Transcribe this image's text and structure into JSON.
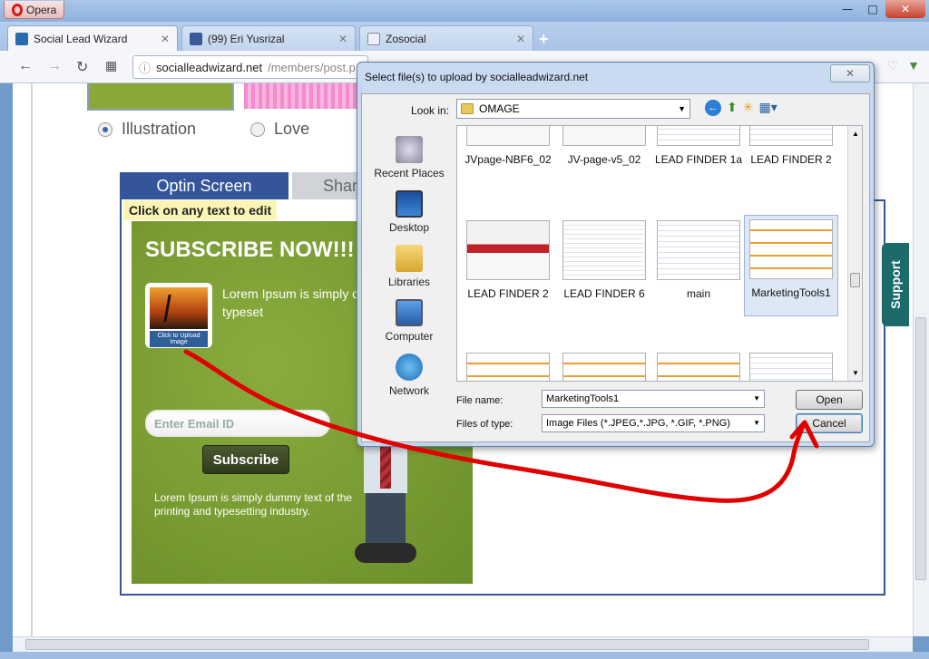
{
  "window": {
    "app_name": "Opera"
  },
  "tabs": [
    {
      "label": "Social Lead Wizard",
      "active": true
    },
    {
      "label": "(99) Eri Yusrizal",
      "active": false
    },
    {
      "label": "Zosocial",
      "active": false
    }
  ],
  "address": {
    "host": "socialleadwizard.net",
    "path": "/members/post.p"
  },
  "page": {
    "radio_options": [
      {
        "label": "Illustration",
        "checked": true
      },
      {
        "label": "Love",
        "checked": false
      }
    ],
    "editor_tabs": {
      "optin": "Optin Screen",
      "share": "Shar"
    },
    "edit_hint": "Click on any text to edit",
    "optin": {
      "title": "SUBSCRIBE NOW!!!",
      "upload_label": "Click to Upload Image",
      "copy1": "Lorem Ipsum is simply d the printing and typeset",
      "email_placeholder": "Enter Email ID",
      "subscribe_label": "Subscribe",
      "copy2": "Lorem Ipsum is simply dummy text of the printing and typesetting industry."
    },
    "support_label": "Support"
  },
  "dialog": {
    "title": "Select file(s) to upload by socialleadwizard.net",
    "look_in_label": "Look in:",
    "look_in_value": "OMAGE",
    "places": [
      "Recent Places",
      "Desktop",
      "Libraries",
      "Computer",
      "Network"
    ],
    "files": [
      {
        "name": "JVpage-NBF6_02",
        "thumb": "web"
      },
      {
        "name": "JV-page-v5_02",
        "thumb": "web"
      },
      {
        "name": "LEAD FINDER 1a",
        "thumb": "sheet"
      },
      {
        "name": "LEAD FINDER 2",
        "thumb": "sheet"
      },
      {
        "name": "LEAD FINDER 2",
        "thumb": "web"
      },
      {
        "name": "LEAD FINDER 6",
        "thumb": "sheet2"
      },
      {
        "name": "main",
        "thumb": "sheet"
      },
      {
        "name": "MarketingTools1",
        "thumb": "tools",
        "selected": true
      },
      {
        "name": "",
        "thumb": "tools"
      },
      {
        "name": "",
        "thumb": "tools"
      },
      {
        "name": "",
        "thumb": "tools"
      },
      {
        "name": "",
        "thumb": "sheet"
      }
    ],
    "file_name_label": "File name:",
    "file_name_value": "MarketingTools1",
    "file_type_label": "Files of type:",
    "file_type_value": "Image Files (*.JPEG,*.JPG, *.GIF, *.PNG)",
    "open_label": "Open",
    "cancel_label": "Cancel"
  },
  "colors": {
    "accent": "#34559a",
    "annotation": "#e00000",
    "optin_bg": "#7a9e34"
  }
}
